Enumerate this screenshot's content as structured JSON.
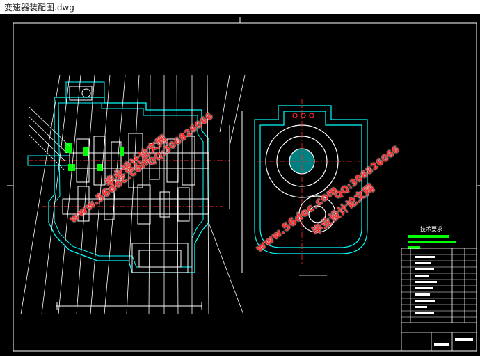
{
  "window": {
    "title": "变速器装配图.dwg"
  },
  "drawing": {
    "tech_requirements_title": "技术要求",
    "watermark_url": "www.56doc.com",
    "watermark_qq": "QQ:306826066",
    "watermark_site": "毕业设计论文网",
    "colors": {
      "background": "#000000",
      "lines": "#ffffff",
      "cyan": "#00ffff",
      "green": "#00ff00",
      "red": "#ff2a2a"
    }
  }
}
